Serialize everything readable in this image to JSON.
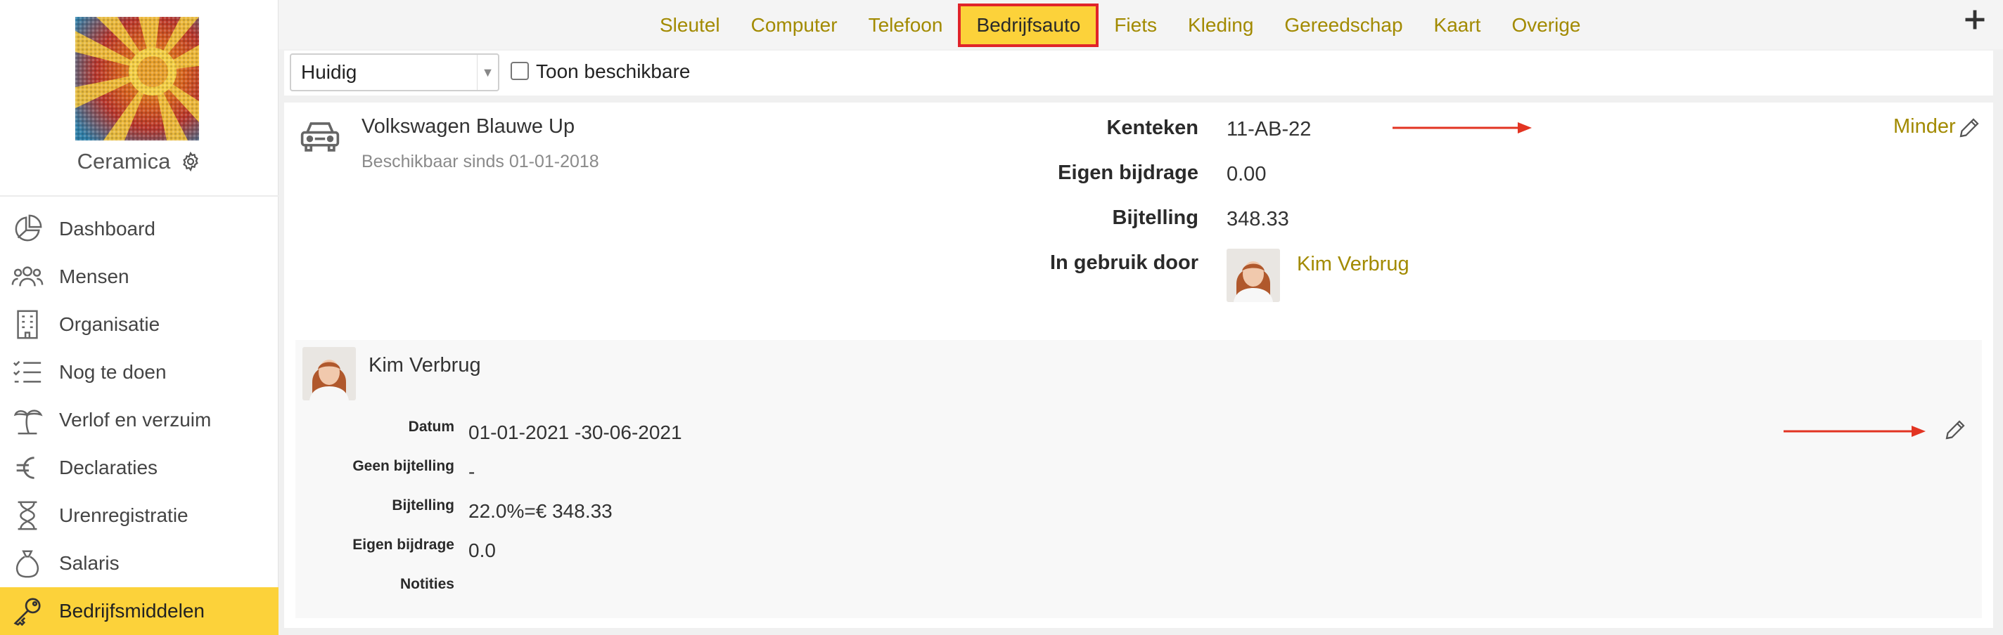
{
  "sidebar": {
    "company_name": "Ceramica",
    "items": [
      {
        "label": "Dashboard",
        "icon": "pie-chart-icon",
        "active": false
      },
      {
        "label": "Mensen",
        "icon": "people-icon",
        "active": false
      },
      {
        "label": "Organisatie",
        "icon": "building-icon",
        "active": false
      },
      {
        "label": "Nog te doen",
        "icon": "checklist-icon",
        "active": false
      },
      {
        "label": "Verlof en verzuim",
        "icon": "palm-tree-icon",
        "active": false
      },
      {
        "label": "Declaraties",
        "icon": "euro-icon",
        "active": false
      },
      {
        "label": "Urenregistratie",
        "icon": "hourglass-icon",
        "active": false
      },
      {
        "label": "Salaris",
        "icon": "money-bag-icon",
        "active": false
      },
      {
        "label": "Bedrijfsmiddelen",
        "icon": "key-icon",
        "active": true
      }
    ]
  },
  "tabs": [
    {
      "label": "Sleutel",
      "active": false
    },
    {
      "label": "Computer",
      "active": false
    },
    {
      "label": "Telefoon",
      "active": false
    },
    {
      "label": "Bedrijfsauto",
      "active": true
    },
    {
      "label": "Fiets",
      "active": false
    },
    {
      "label": "Kleding",
      "active": false
    },
    {
      "label": "Gereedschap",
      "active": false
    },
    {
      "label": "Kaart",
      "active": false
    },
    {
      "label": "Overige",
      "active": false
    }
  ],
  "filter": {
    "select_value": "Huidig",
    "checkbox_label": "Toon beschikbare",
    "checkbox_checked": false
  },
  "asset": {
    "name": "Volkswagen Blauwe Up",
    "subtitle": "Beschikbaar sinds 01-01-2018",
    "toggle_label": "Minder",
    "details": [
      {
        "label": "Kenteken",
        "value": "11-AB-22"
      },
      {
        "label": "Eigen bijdrage",
        "value": "0.00"
      },
      {
        "label": "Bijtelling",
        "value": "348.33"
      },
      {
        "label": "In gebruik door",
        "value": "Kim Verbrug"
      }
    ]
  },
  "history": {
    "user_name": "Kim Verbrug",
    "rows": [
      {
        "label": "Datum",
        "value": "01-01-2021 -30-06-2021"
      },
      {
        "label": "Geen bijtelling",
        "value": "-"
      },
      {
        "label": "Bijtelling",
        "value": "22.0%=€ 348.33"
      },
      {
        "label": "Eigen bijdrage",
        "value": "0.0"
      },
      {
        "label": "Notities",
        "value": ""
      }
    ]
  },
  "colors": {
    "accent_yellow": "#fcd23a",
    "link_gold": "#a28a00",
    "highlight_red": "#e0242a"
  }
}
